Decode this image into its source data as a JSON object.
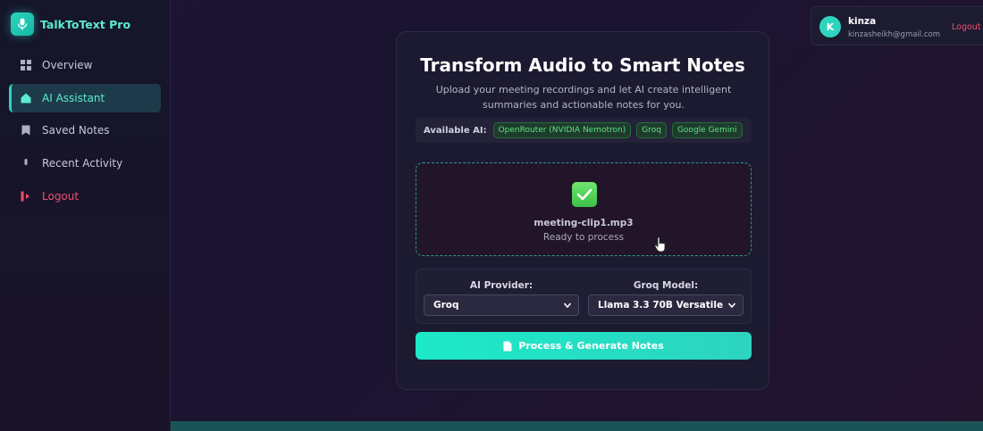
{
  "app": {
    "name": "TalkToText Pro",
    "logo_icon": "microphone-icon"
  },
  "sidebar": {
    "items": [
      {
        "label": "Overview",
        "icon": "grid-icon",
        "active": false
      },
      {
        "label": "AI Assistant",
        "icon": "home-icon",
        "active": true
      },
      {
        "label": "Saved Notes",
        "icon": "bookmark-icon",
        "active": false
      },
      {
        "label": "Recent Activity",
        "icon": "mic-dot-icon",
        "active": false
      },
      {
        "label": "Logout",
        "icon": "logout-icon",
        "active": false
      }
    ]
  },
  "user": {
    "initial": "K",
    "name": "kinza",
    "email": "kinzasheikh@gmail.com",
    "logout_label": "Logout"
  },
  "main": {
    "title": "Transform Audio to Smart Notes",
    "subtitle": "Upload your meeting recordings and let AI create intelligent summaries and actionable notes for you.",
    "available_ai_label": "Available AI:",
    "providers": [
      "OpenRouter (NVIDIA Nemotron)",
      "Groq",
      "Google Gemini"
    ],
    "upload": {
      "icon": "check-mark-icon",
      "file_name": "meeting-clip1.mp3",
      "status": "Ready to process"
    },
    "provider_select": {
      "label": "AI Provider:",
      "value": "Groq"
    },
    "model_select": {
      "label": "Groq Model:",
      "value": "Llama 3.3 70B Versatile"
    },
    "process_button": "Process & Generate Notes"
  },
  "colors": {
    "accent": "#2dd4bf",
    "danger": "#f0506e",
    "badge_text": "#5ee27f",
    "background": "#1b1433"
  }
}
